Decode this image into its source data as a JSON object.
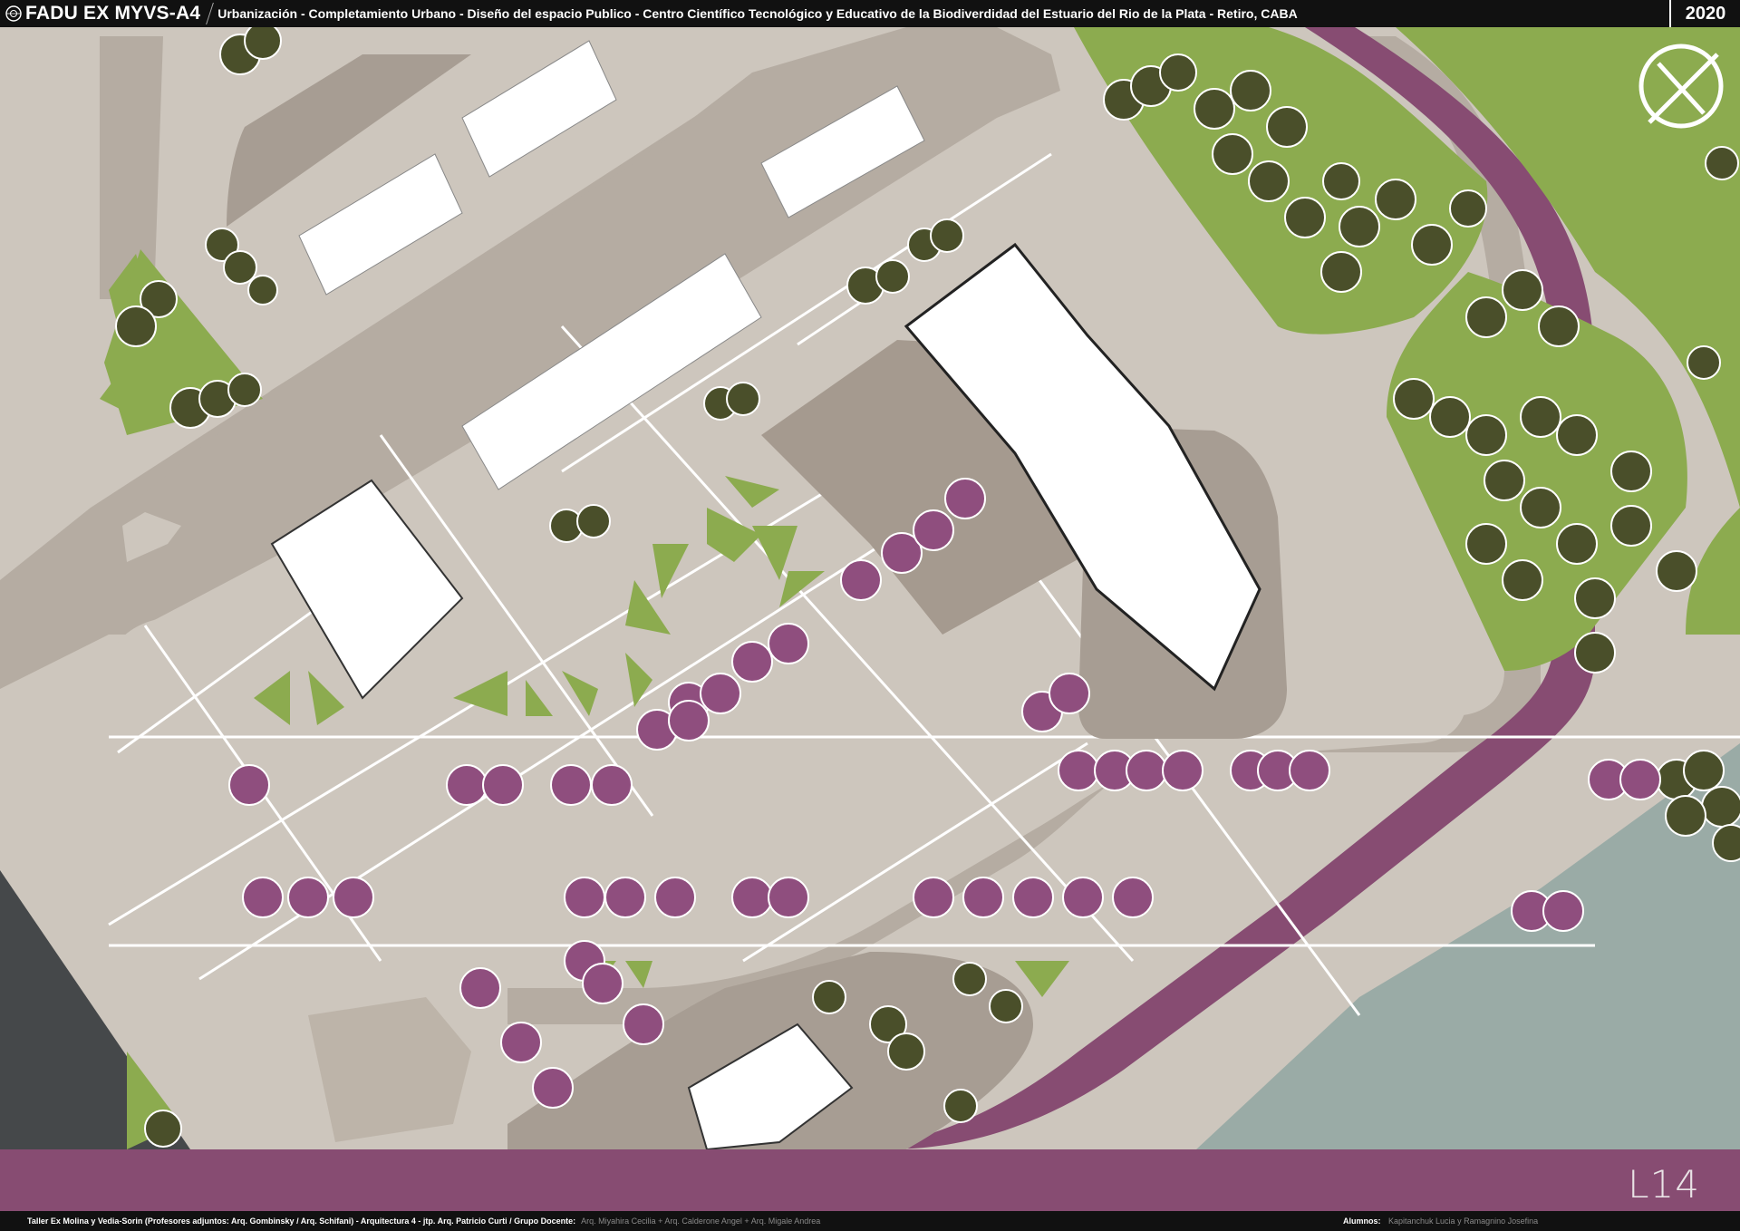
{
  "header": {
    "logo_icon": "fadu-seal-icon",
    "brand": "FADU EX MYVS-A4",
    "description": "Urbanización - Completamiento Urbano - Diseño del espacio Publico - Centro Científico Tecnológico y Educativo de la Biodiverdidad del Estuario del Rio de la Plata   - Retiro, CABA",
    "year": "2020"
  },
  "sheet": {
    "number": "L14"
  },
  "footer": {
    "team_label": "Taller Ex Molina y Vedia-Sorin (Profesores adjuntos:  Arq. Gombinsky / Arq. Schifani) - Arquitectura 4 - jtp. Arq. Patricio Curti / Grupo Docente:",
    "team_names": "Arq. Miyahira Cecilia  +  Arq. Calderone Angel  +  Arq. Migale Andrea",
    "students_label": "Alumnos:",
    "students_names": "Kapitanchuk Lucia  y  Ramagnino Josefina"
  },
  "plan": {
    "north_symbol_icon": "north-arrow-icon",
    "colors": {
      "paving": "#cdc6bd",
      "road": "#b5aca2",
      "sidewalk": "#dcd6ce",
      "grass": "#8cab4f",
      "path_purple": "#874c72",
      "water": "#9aaba6",
      "tree_dark": "#4a4f2a",
      "tree_purple": "#8f4e7e",
      "building": "#ffffff",
      "dark_ground": "#45484a"
    }
  }
}
